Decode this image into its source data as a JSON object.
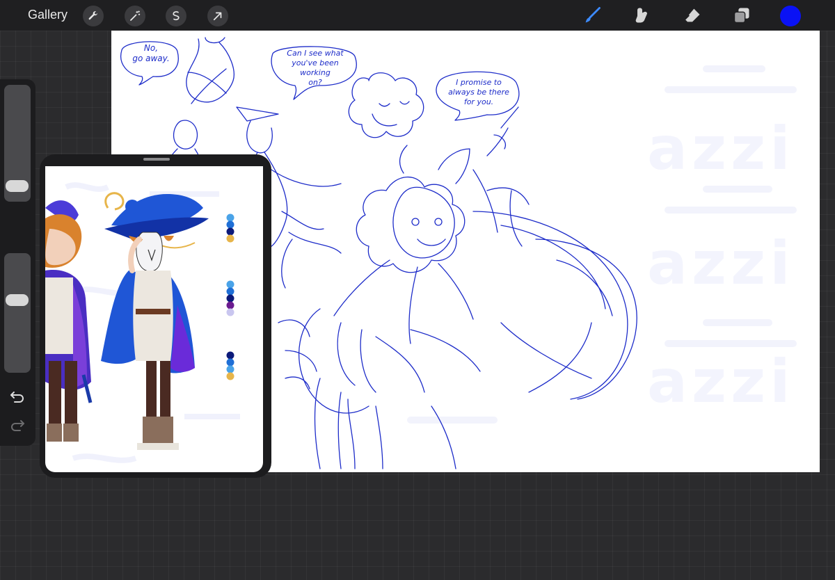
{
  "topbar": {
    "gallery_label": "Gallery",
    "left_tools": [
      {
        "name": "wrench-icon",
        "label": "Actions"
      },
      {
        "name": "magic-wand-icon",
        "label": "Adjustments"
      },
      {
        "name": "selection-icon",
        "label": "Selection"
      },
      {
        "name": "transform-arrow-icon",
        "label": "Transform"
      }
    ],
    "right_tools": [
      {
        "name": "brush-icon",
        "active": true
      },
      {
        "name": "smudge-icon",
        "active": false
      },
      {
        "name": "eraser-icon",
        "active": false
      },
      {
        "name": "layers-icon",
        "active": false
      }
    ],
    "current_color": "#0a12f5"
  },
  "sidebar": {
    "brush_size_level": 0.08,
    "opacity_level": 0.62,
    "icons": [
      "square-modify-icon",
      "undo-icon",
      "redo-icon"
    ]
  },
  "canvas": {
    "bubbles": {
      "no_go_away": "No,\ngo away.",
      "can_i_see": "Can I see what\nyou've been working\non?",
      "promise": "I promise to\nalways be there\nfor you."
    },
    "watermark": "azzi",
    "stroke_color": "#1d2cc9"
  },
  "reference_window": {
    "palette_swatches": [
      [
        "#4aa3e8",
        "#1f6fd6",
        "#0c1a7a",
        "#e7b54a"
      ],
      [
        "#4aa3e8",
        "#1f6fd6",
        "#0c1a7a",
        "#6a1b8f",
        "#c9c6ef"
      ],
      [
        "#0c1a7a",
        "#1f6fd6",
        "#4aa3e8",
        "#e7b54a"
      ]
    ]
  },
  "colors": {
    "accent": "#0a12f5",
    "toolbar_bg": "#1f1f21",
    "canvas_bg": "#ffffff"
  }
}
